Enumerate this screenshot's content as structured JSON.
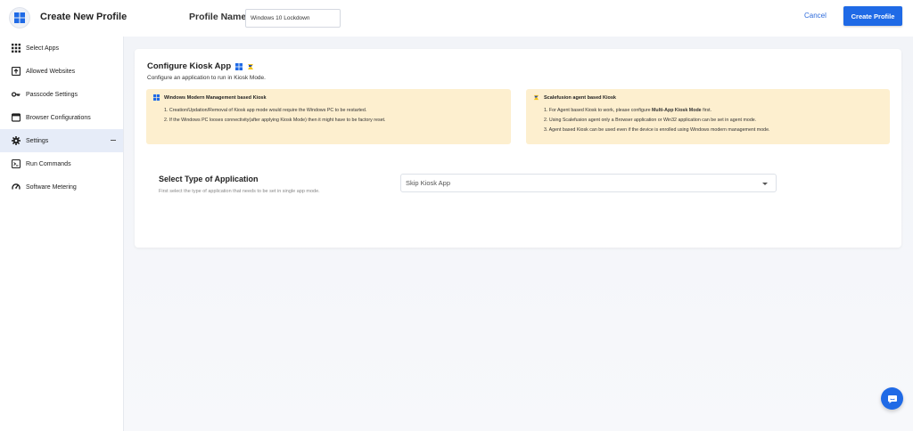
{
  "header": {
    "title": "Create New Profile",
    "profile_name_label": "Profile Name",
    "profile_name_value": "Windows 10 Lockdown",
    "cancel_label": "Cancel",
    "create_label": "Create Profile"
  },
  "sidebar": {
    "items": [
      {
        "label": "Select Apps",
        "icon": "grid-icon"
      },
      {
        "label": "Allowed Websites",
        "icon": "upload-box-icon"
      },
      {
        "label": "Passcode Settings",
        "icon": "key-icon"
      },
      {
        "label": "Browser Configurations",
        "icon": "browser-icon"
      },
      {
        "label": "Settings",
        "icon": "gear-icon",
        "active": true
      },
      {
        "label": "Run Commands",
        "icon": "terminal-icon"
      },
      {
        "label": "Software Metering",
        "icon": "gauge-icon"
      }
    ]
  },
  "card": {
    "title": "Configure Kiosk App",
    "subtitle": "Configure an application to run in Kiosk Mode.",
    "left_box": {
      "title": "Windows Modern Management based Kiosk",
      "items": [
        "1. Creation/Updation/Removal of Kiosk app mode would require the Windows PC to be restarted.",
        "2. If the Windows PC looses connectivity(after applying Kiosk Mode) then it might have to be factory reset."
      ]
    },
    "right_box": {
      "title": "Scalefusion agent based Kiosk",
      "item1_prefix": "1. For Agent based Kiosk to work, please configure ",
      "item1_bold": "Multi-App Kiosk Mode",
      "item1_suffix": " first.",
      "item2": "2. Using Scalefusion agent only a Browser application or Win32 application can be set in agent mode.",
      "item3": "3. Agent based Kiosk can be used even if the device is enrolled using Windows modern management mode."
    },
    "select_label": "Select Type of Application",
    "select_hint": "First select the type of application that needs to be set in single app mode.",
    "select_value": "Skip Kiosk App"
  },
  "colors": {
    "accent": "#1f6ae6",
    "info_box_bg": "#fdefcf",
    "active_nav_bg": "#e6ecf8"
  }
}
